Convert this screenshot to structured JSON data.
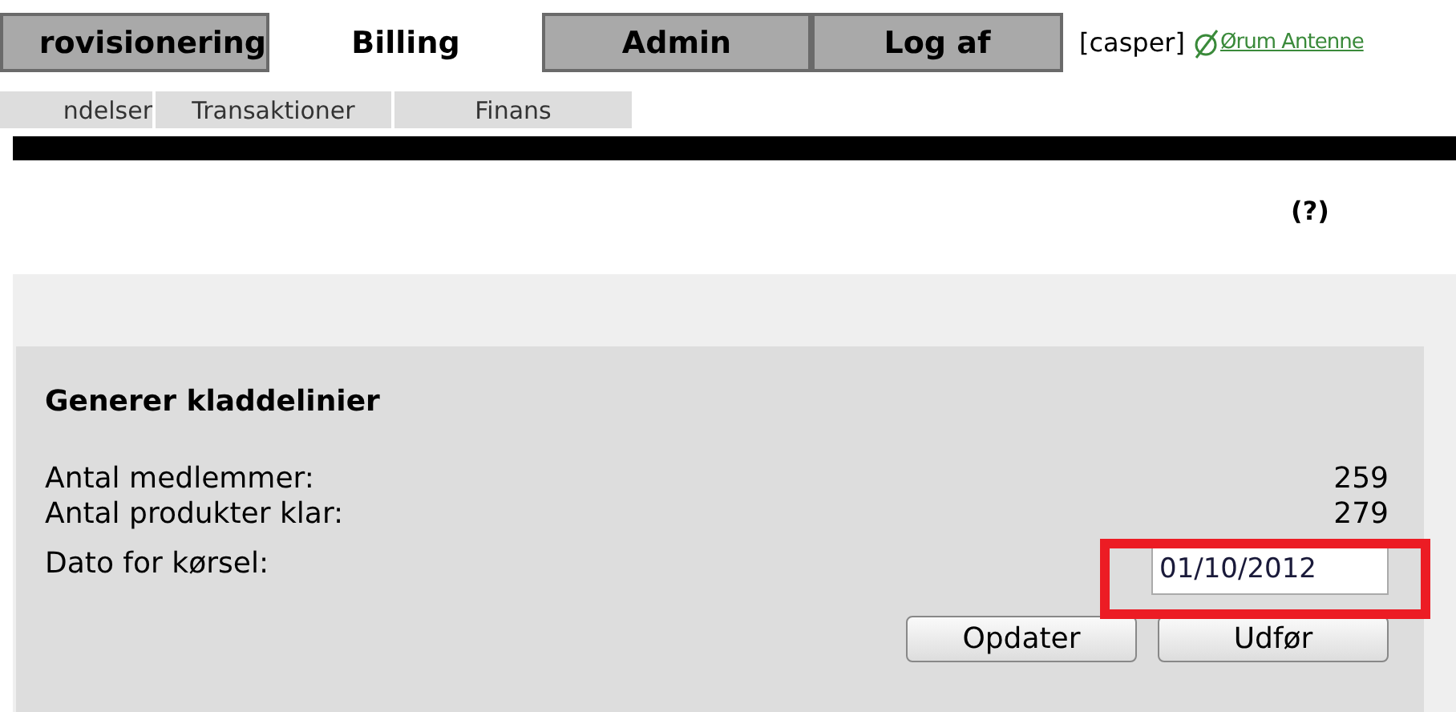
{
  "tabs": [
    {
      "label": "rovisionering",
      "selected": false
    },
    {
      "label": "Billing",
      "selected": true
    },
    {
      "label": "Admin",
      "selected": false
    },
    {
      "label": "Log af",
      "selected": false
    }
  ],
  "user": "[casper]",
  "brand_link": "Ørum Antenne",
  "subtabs": [
    "ndelser",
    "Transaktioner",
    "Finans"
  ],
  "help": "(?)",
  "panel": {
    "title": "Generer kladdelinier",
    "rows": [
      {
        "label": "Antal medlemmer:",
        "kind": "value",
        "value": "259"
      },
      {
        "label": "Antal produkter klar:",
        "kind": "value",
        "value": "279"
      },
      {
        "label": "Dato for kørsel:",
        "kind": "date",
        "value": "01/10/2012"
      }
    ],
    "buttons": [
      "Opdater",
      "Udfør"
    ],
    "highlight": true
  }
}
